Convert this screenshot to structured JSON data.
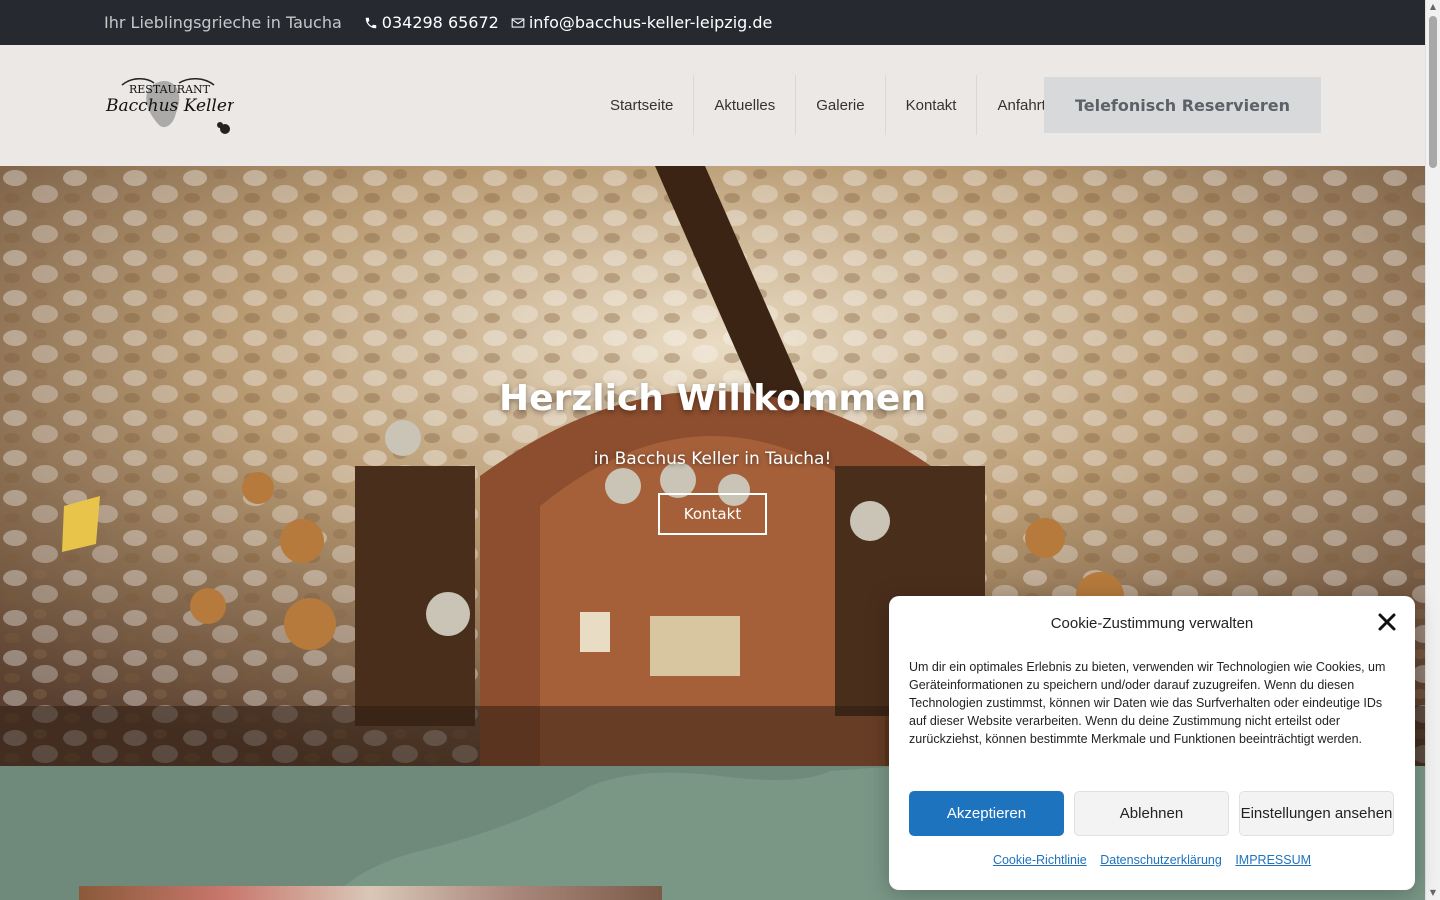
{
  "topbar": {
    "tagline": "Ihr Lieblingsgrieche in Taucha",
    "phone": "034298 65672",
    "email": "info@bacchus-keller-leipzig.de"
  },
  "header": {
    "logo_top": "RESTAURANT",
    "logo_name": "Bacchus Keller",
    "nav": [
      "Startseite",
      "Aktuelles",
      "Galerie",
      "Kontakt",
      "Anfahrt"
    ],
    "reserve_label": "Telefonisch Reservieren"
  },
  "hero": {
    "title": "Herzlich Willkommen",
    "subtitle": "in Bacchus Keller in Taucha!",
    "button": "Kontakt"
  },
  "cookie": {
    "title": "Cookie-Zustimmung verwalten",
    "text": "Um dir ein optimales Erlebnis zu bieten, verwenden wir Technologien wie Cookies, um Geräteinformationen zu speichern und/oder darauf zuzugreifen. Wenn du diesen Technologien zustimmst, können wir Daten wie das Surfverhalten oder eindeutige IDs auf dieser Website verarbeiten. Wenn du deine Zustimmung nicht erteilst oder zurückziehst, können bestimmte Merkmale und Funktionen beeinträchtigt werden.",
    "accept": "Akzeptieren",
    "deny": "Ablehnen",
    "settings": "Einstellungen ansehen",
    "links": [
      "Cookie-Richtlinie",
      "Datenschutzerklärung",
      "IMPRESSUM"
    ]
  },
  "colors": {
    "topbar_bg": "#262a30",
    "header_bg": "#ece8e5",
    "accent_blue": "#1e73be",
    "section_green": "#6f8a7a"
  }
}
